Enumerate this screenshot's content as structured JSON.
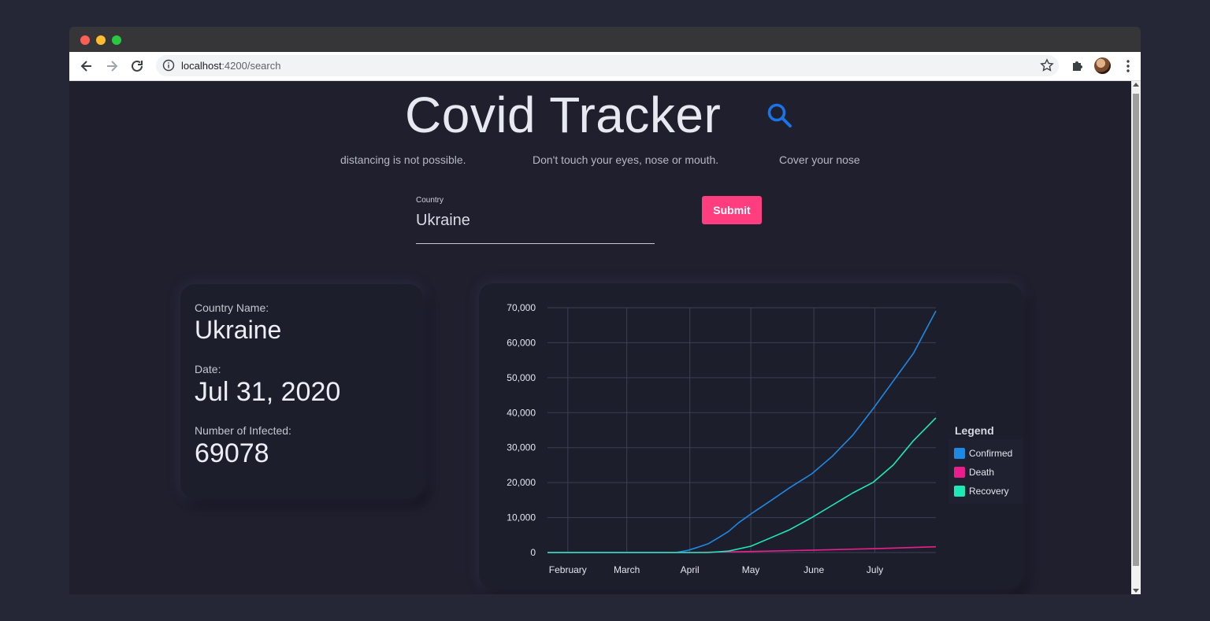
{
  "browser": {
    "url_host": "localhost",
    "url_rest": ":4200/search"
  },
  "page": {
    "title": "Covid Tracker",
    "ticker": [
      "distancing is not possible.",
      "Don't touch your eyes, nose or mouth.",
      "Cover your nose a"
    ]
  },
  "form": {
    "country_label": "Country",
    "country_value": "Ukraine",
    "submit_label": "Submit"
  },
  "info": {
    "country_label": "Country Name:",
    "country_value": "Ukraine",
    "date_label": "Date:",
    "date_value": "Jul 31, 2020",
    "infected_label": "Number of Infected:",
    "infected_value": "69078"
  },
  "colors": {
    "accent": "#ff3d7f",
    "search": "#1a73e8",
    "confirmed": "#1e88e5",
    "death": "#e91e8c",
    "recovery": "#1de9b6"
  },
  "chart_data": {
    "type": "line",
    "ylim": [
      0,
      70000
    ],
    "yticks": [
      "0",
      "10,000",
      "20,000",
      "30,000",
      "40,000",
      "50,000",
      "60,000",
      "70,000"
    ],
    "xticks": [
      "February",
      "March",
      "April",
      "May",
      "June",
      "July"
    ],
    "legend_title": "Legend",
    "series": [
      {
        "name": "Confirmed",
        "color": "#1e88e5",
        "values": [
          [
            "2020-01-22",
            0
          ],
          [
            "2020-03-25",
            0
          ],
          [
            "2020-03-31",
            600
          ],
          [
            "2020-04-05",
            1500
          ],
          [
            "2020-04-10",
            2500
          ],
          [
            "2020-04-15",
            4200
          ],
          [
            "2020-04-20",
            6000
          ],
          [
            "2020-04-25",
            8500
          ],
          [
            "2020-05-01",
            11000
          ],
          [
            "2020-05-10",
            14500
          ],
          [
            "2020-05-20",
            18500
          ],
          [
            "2020-05-31",
            22500
          ],
          [
            "2020-06-10",
            27500
          ],
          [
            "2020-06-20",
            33500
          ],
          [
            "2020-06-30",
            41000
          ],
          [
            "2020-07-10",
            49000
          ],
          [
            "2020-07-20",
            57000
          ],
          [
            "2020-07-31",
            69078
          ]
        ]
      },
      {
        "name": "Death",
        "color": "#e91e8c",
        "values": [
          [
            "2020-01-22",
            0
          ],
          [
            "2020-04-01",
            0
          ],
          [
            "2020-04-15",
            150
          ],
          [
            "2020-05-01",
            300
          ],
          [
            "2020-06-01",
            700
          ],
          [
            "2020-07-01",
            1100
          ],
          [
            "2020-07-31",
            1650
          ]
        ]
      },
      {
        "name": "Recovery",
        "color": "#1de9b6",
        "values": [
          [
            "2020-01-22",
            0
          ],
          [
            "2020-04-10",
            0
          ],
          [
            "2020-04-20",
            400
          ],
          [
            "2020-05-01",
            1800
          ],
          [
            "2020-05-10",
            4000
          ],
          [
            "2020-05-20",
            6500
          ],
          [
            "2020-05-31",
            10000
          ],
          [
            "2020-06-10",
            13500
          ],
          [
            "2020-06-20",
            17000
          ],
          [
            "2020-06-30",
            20000
          ],
          [
            "2020-07-10",
            25000
          ],
          [
            "2020-07-20",
            32000
          ],
          [
            "2020-07-31",
            38500
          ]
        ]
      }
    ]
  }
}
